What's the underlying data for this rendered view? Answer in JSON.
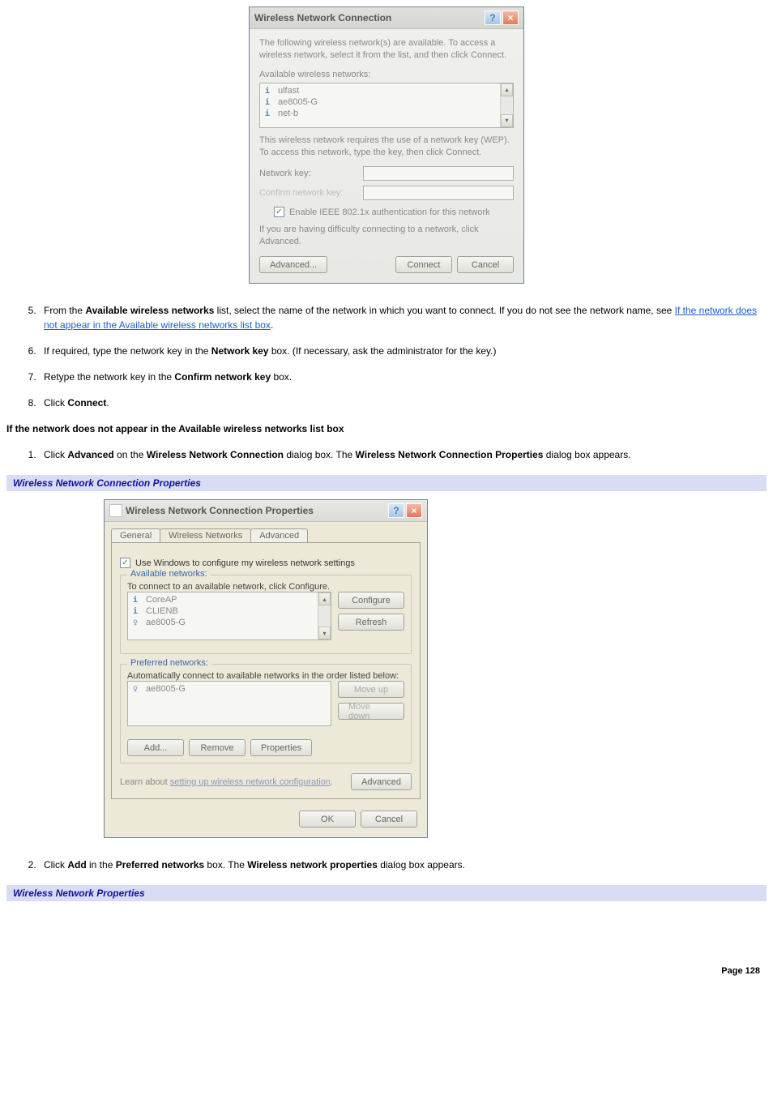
{
  "dialog1": {
    "title": "Wireless Network Connection",
    "intro": "The following wireless network(s) are available. To access a wireless network, select it from the list, and then click Connect.",
    "avail_label": "Available wireless networks:",
    "networks": [
      "ulfast",
      "ae8005-G",
      "net-b"
    ],
    "wep_text": "This wireless network requires the use of a network key (WEP). To access this network, type the key, then click Connect.",
    "netkey_label": "Network key:",
    "confirm_label": "Confirm network key:",
    "ieee_checkbox": "Enable IEEE 802.1x authentication for this network",
    "diff_text": "If you are having difficulty connecting to a network, click Advanced.",
    "advanced_btn": "Advanced...",
    "connect_btn": "Connect",
    "cancel_btn": "Cancel"
  },
  "step5_a": "From the ",
  "step5_b": "Available wireless networks",
  "step5_c": " list, select the name of the network in which you want to connect. If you do not see the network name, see ",
  "step5_link": "If the network does not appear in the Available wireless networks list box",
  "step5_d": ".",
  "step6_a": "If required, type the network key in the ",
  "step6_b": "Network key",
  "step6_c": " box. (If necessary, ask the administrator for the key.)",
  "step7_a": "Retype the network key in the ",
  "step7_b": "Confirm network key",
  "step7_c": " box.",
  "step8_a": "Click ",
  "step8_b": "Connect",
  "step8_c": ".",
  "section_heading": "If the network does not appear in the Available wireless networks list box",
  "sub1_a": "Click ",
  "sub1_b": "Advanced",
  "sub1_c": " on the ",
  "sub1_d": "Wireless Network Connection",
  "sub1_e": " dialog box. The ",
  "sub1_f": "Wireless Network Connection Properties",
  "sub1_g": " dialog box appears.",
  "bar1": "Wireless Network Connection Properties",
  "dialog2": {
    "title": "Wireless Network Connection Properties",
    "tab_general": "General",
    "tab_wireless": "Wireless Networks",
    "tab_advanced": "Advanced",
    "use_windows": "Use Windows to configure my wireless network settings",
    "avail_group": "Available networks:",
    "avail_desc": "To connect to an available network, click Configure.",
    "avail_items": [
      "CoreAP",
      "CLIENB",
      "ae8005-G"
    ],
    "configure_btn": "Configure",
    "refresh_btn": "Refresh",
    "pref_group": "Preferred networks:",
    "pref_desc": "Automatically connect to available networks in the order listed below:",
    "pref_items": [
      "ae8005-G"
    ],
    "moveup_btn": "Move up",
    "movedown_btn": "Move down",
    "add_btn": "Add...",
    "remove_btn": "Remove",
    "properties_btn": "Properties",
    "learn_text1": "Learn about ",
    "learn_link": "setting up wireless network configuration",
    "learn_text2": ".",
    "advanced_btn": "Advanced",
    "ok_btn": "OK",
    "cancel_btn": "Cancel"
  },
  "sub2_a": "Click ",
  "sub2_b": "Add",
  "sub2_c": " in the ",
  "sub2_d": "Preferred networks",
  "sub2_e": " box. The ",
  "sub2_f": "Wireless network properties",
  "sub2_g": " dialog box appears.",
  "bar2": "Wireless Network Properties",
  "page_num": "Page 128"
}
